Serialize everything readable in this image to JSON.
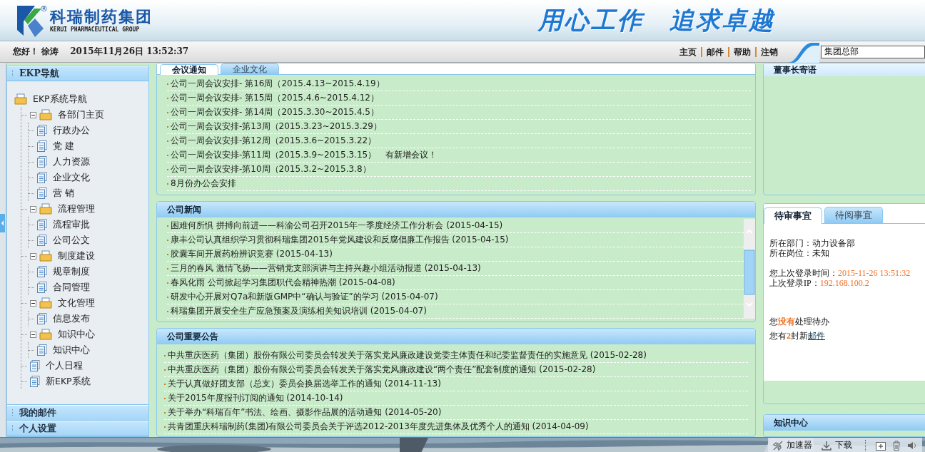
{
  "header": {
    "registered": "®",
    "logo_cn": "科瑞制药集团",
    "logo_en": "KERUI PHARMACEUTICAL GROUP",
    "slogan": [
      "用心工作",
      "追求卓越"
    ]
  },
  "topbar": {
    "greeting": "您好！ 徐涛",
    "datetime": "2015年11月26日  13:52:37",
    "links": [
      "主页",
      "邮件",
      "帮助",
      "注销"
    ],
    "search": {
      "value": "集团总部"
    }
  },
  "sidebar": {
    "sections": [
      {
        "title": "EKP导航",
        "tree": {
          "label": "EKP系统导航",
          "kind": "folder",
          "children": [
            {
              "label": "各部门主页",
              "kind": "folder",
              "expanded": true,
              "children": [
                {
                  "label": "行政办公",
                  "kind": "page"
                },
                {
                  "label": "党 建",
                  "kind": "page"
                },
                {
                  "label": "人力资源",
                  "kind": "page"
                },
                {
                  "label": "企业文化",
                  "kind": "page"
                },
                {
                  "label": "营 销",
                  "kind": "page"
                }
              ]
            },
            {
              "label": "流程管理",
              "kind": "folder",
              "expanded": true,
              "children": [
                {
                  "label": "流程审批",
                  "kind": "page"
                },
                {
                  "label": "公司公文",
                  "kind": "page"
                }
              ]
            },
            {
              "label": "制度建设",
              "kind": "folder",
              "expanded": true,
              "children": [
                {
                  "label": "规章制度",
                  "kind": "page"
                },
                {
                  "label": "合同管理",
                  "kind": "page"
                }
              ]
            },
            {
              "label": "文化管理",
              "kind": "folder",
              "expanded": true,
              "children": [
                {
                  "label": "信息发布",
                  "kind": "page"
                }
              ]
            },
            {
              "label": "知识中心",
              "kind": "folder",
              "expanded": true,
              "children": [
                {
                  "label": "知识中心",
                  "kind": "page"
                }
              ]
            },
            {
              "label": "个人日程",
              "kind": "page"
            },
            {
              "label": "新EKP系统",
              "kind": "page"
            }
          ]
        }
      },
      {
        "title": "我的邮件"
      },
      {
        "title": "个人设置"
      }
    ]
  },
  "notices": {
    "tabs": [
      {
        "label": "会议通知",
        "selected": true
      },
      {
        "label": "企业文化",
        "selected": false
      }
    ],
    "items": [
      {
        "text": "公司一周会议安排- 第16周（2015.4.13~2015.4.19）"
      },
      {
        "text": "公司一周会议安排- 第15周（2015.4.6~2015.4.12）"
      },
      {
        "text": "公司一周会议安排- 第14周（2015.3.30~2015.4.5）"
      },
      {
        "text": "公司一周会议安排-第13周（2015.3.23~2015.3.29）"
      },
      {
        "text": "公司一周会议安排-第12周（2015.3.6~2015.3.22）"
      },
      {
        "text": "公司一周会议安排-第11周（2015.3.9~2015.3.15）",
        "note": "有新增会议！"
      },
      {
        "text": "公司一周会议安排-第10周（2015.3.2~2015.3.8）"
      },
      {
        "text": "8月份办公会安排"
      }
    ]
  },
  "news": {
    "title": "公司新闻",
    "items": [
      "困难何所惧 拼搏向前进——科渝公司召开2015年一季度经济工作分析会 (2015-04-15)",
      "康丰公司认真组织学习贯彻科瑞集团2015年党风建设和反腐倡廉工作报告 (2015-04-15)",
      "胶囊车间开展药粉辨识竞赛 (2015-04-13)",
      "三月的春风 激情飞扬——营销党支部演讲与主持兴趣小组活动报道 (2015-04-13)",
      "春风化雨 公司掀起学习集团职代会精神热潮 (2015-04-08)",
      "研发中心开展对Q7a和新版GMP中“确认与验证”的学习 (2015-04-07)",
      "科瑞集团开展安全生产应急预案及演练相关知识培训 (2015-04-07)"
    ]
  },
  "announcements": {
    "title": "公司重要公告",
    "items": [
      "中共重庆医药（集团）股份有限公司委员会转发关于落实党风廉政建设党委主体责任和纪委监督责任的实施意见 (2015-02-28)",
      "中共重庆医药（集团）股份有限公司委员会转发关于落实党风廉政建设“两个责任”配套制度的通知 (2015-02-28)",
      "关于认真做好团支部（总支）委员会换届选举工作的通知 (2014-11-13)",
      "关于2015年度报刊订阅的通知 (2014-10-14)",
      "关于举办“科瑞百年”书法、绘画、摄影作品展的活动通知 (2014-05-20)",
      "共青团重庆科瑞制药(集团)有限公司委员会关于评选2012-2013年度先进集体及优秀个人的通知 (2014-04-09)"
    ]
  },
  "right": {
    "top_panel": {
      "title": "董事长寄语"
    },
    "tasks": {
      "tabs": [
        {
          "label": "待审事宜",
          "selected": true
        },
        {
          "label": "待阅事宜",
          "selected": false
        }
      ],
      "department": "所在部门：动力设备部",
      "position": "所在岗位：未知",
      "last_login_label": "您上次登录时间：",
      "last_login": "2015-11-26 13:51:32",
      "last_ip_label": "上次登录IP：",
      "last_ip": "192.168.100.2",
      "todo": "您**没有**处理待办",
      "mail": "您有**2**封新",
      "mail_link": "邮件"
    },
    "bottom_panel": {
      "title": "知识中心"
    }
  },
  "status_bar": {
    "items": [
      "加速器",
      "下载"
    ]
  }
}
